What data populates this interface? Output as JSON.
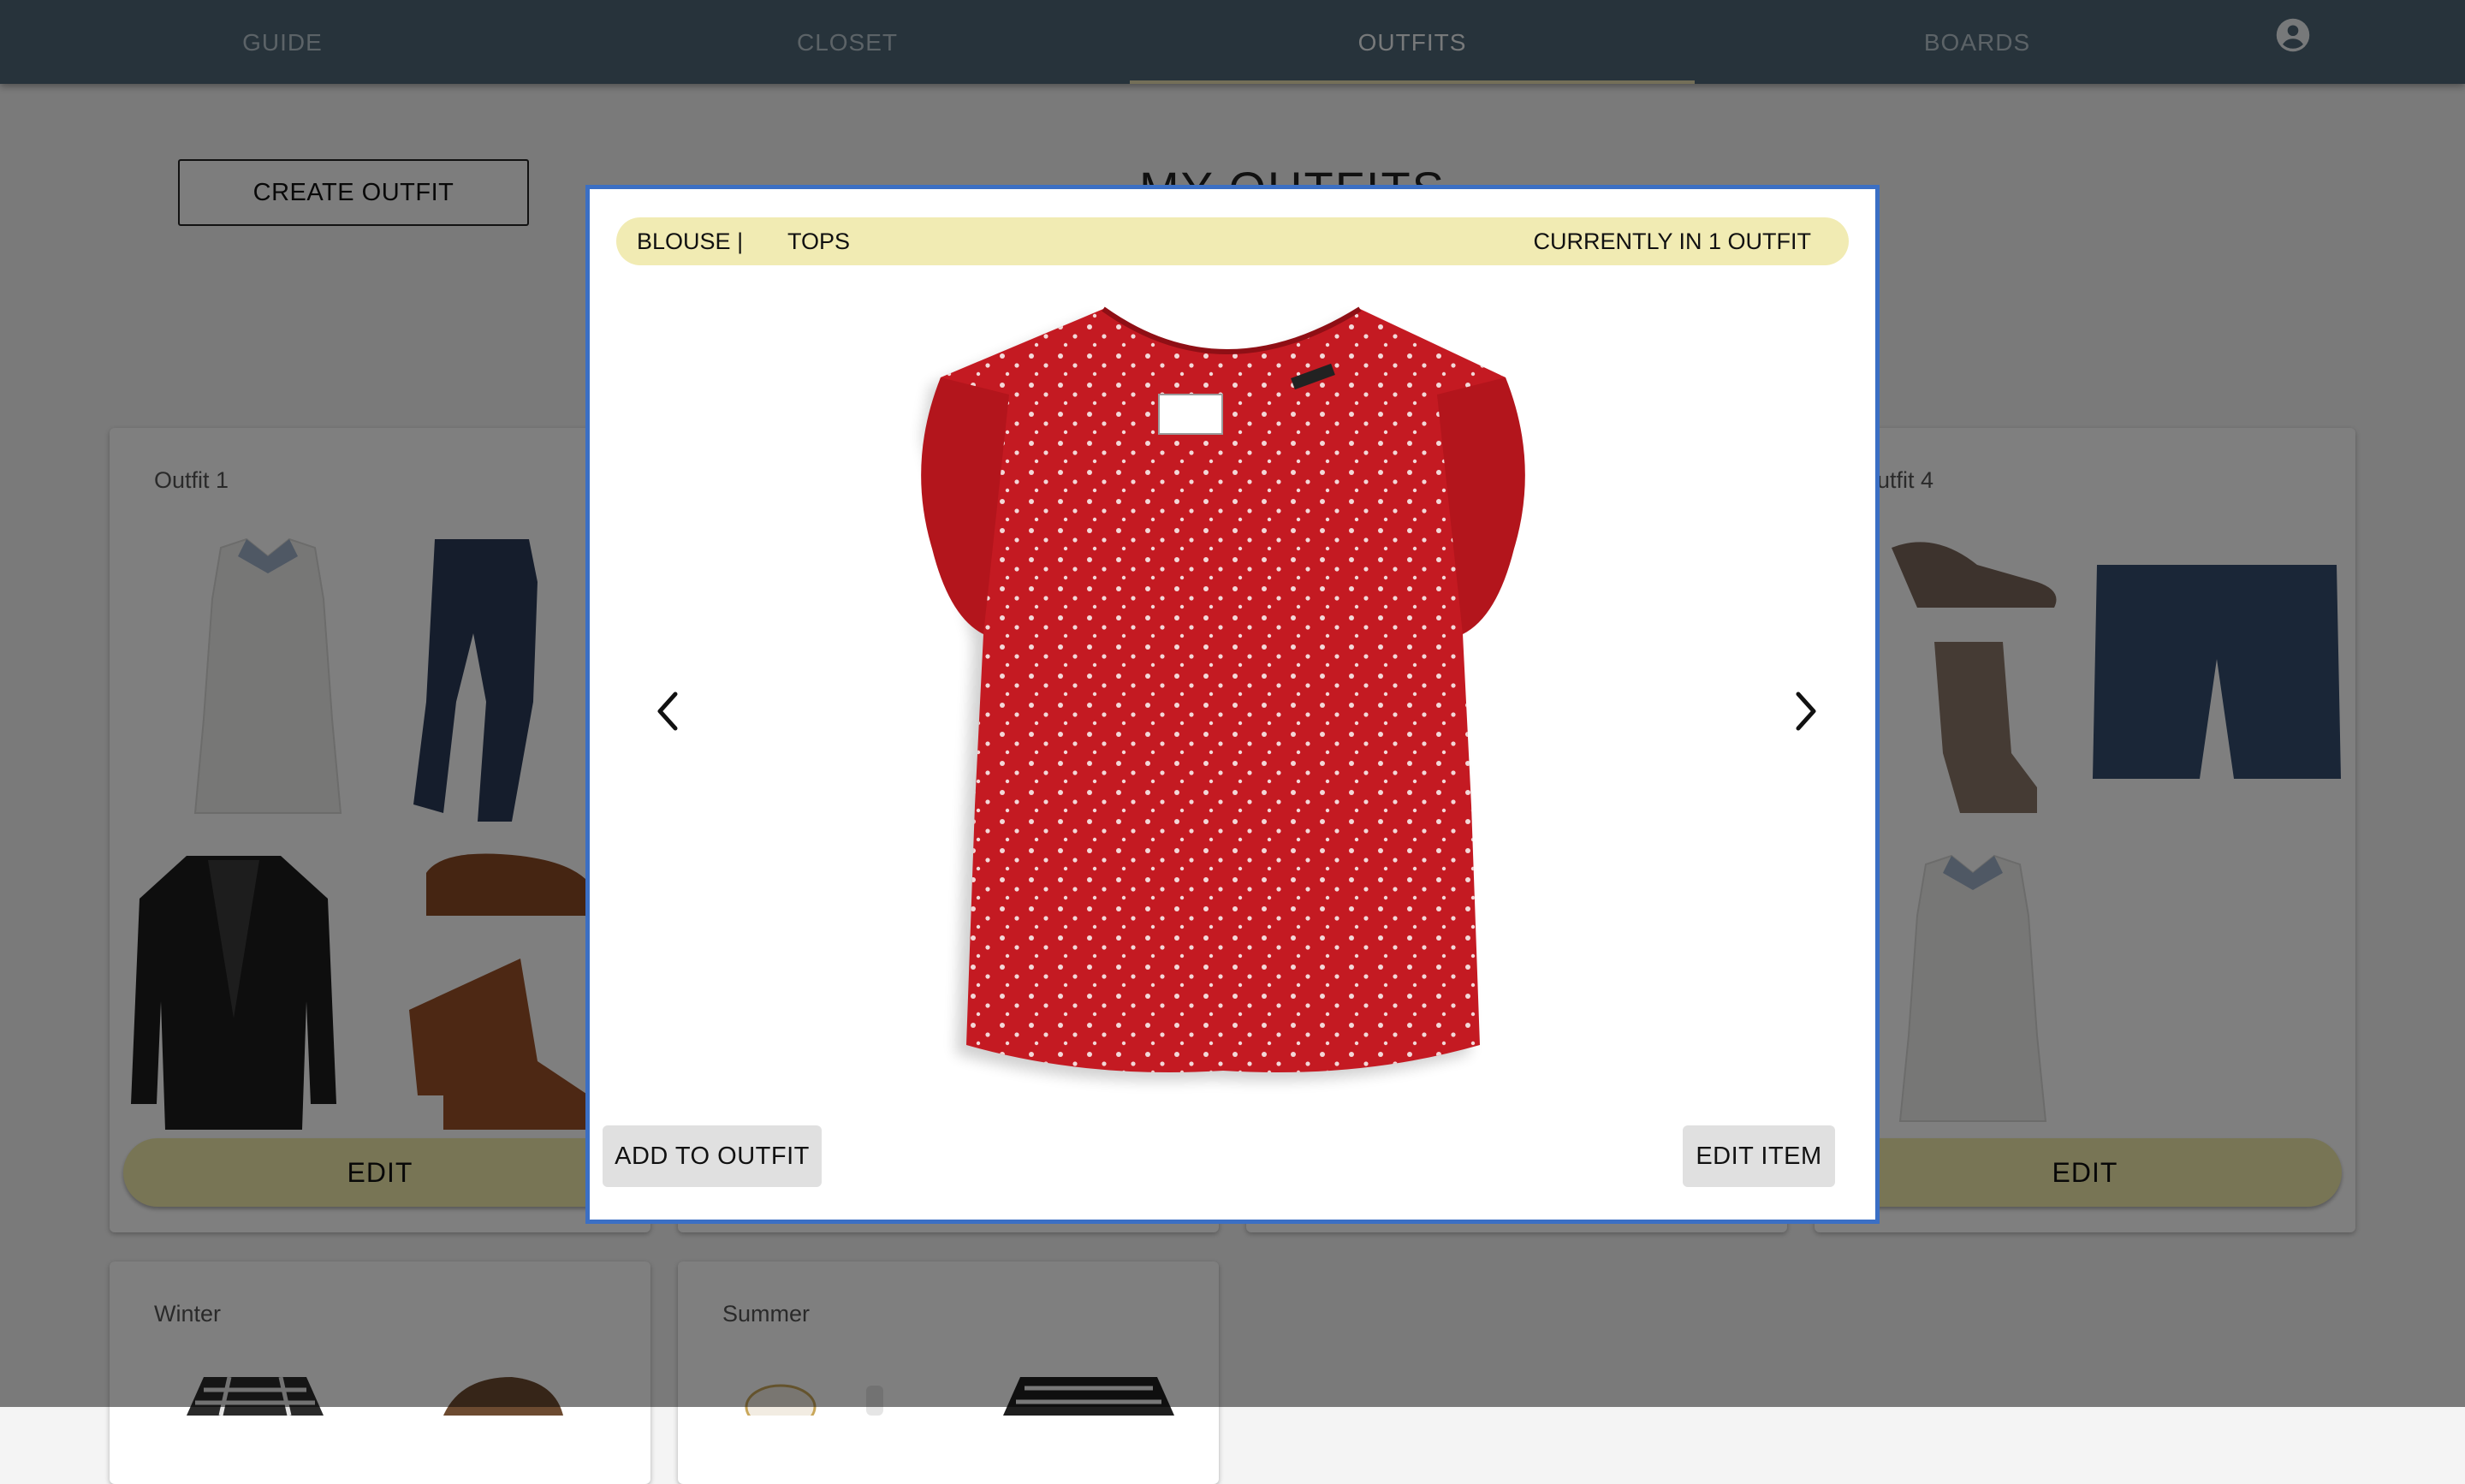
{
  "nav": {
    "tabs": [
      {
        "label": "GUIDE"
      },
      {
        "label": "CLOSET"
      },
      {
        "label": "OUTFITS"
      },
      {
        "label": "BOARDS"
      }
    ],
    "active_tab": "OUTFITS",
    "account_icon": "account-circle-icon"
  },
  "page": {
    "title": "MY OUTFITS",
    "create_button": "CREATE OUTFIT"
  },
  "outfits": [
    {
      "name": "Outfit 1",
      "edit_label": "EDIT"
    },
    {
      "name": "Outfit 4",
      "edit_label": "EDIT"
    },
    {
      "name": "Winter"
    },
    {
      "name": "Summer"
    }
  ],
  "modal": {
    "item_type": "BLOUSE",
    "separator": "|",
    "category": "TOPS",
    "usage": "CURRENTLY IN 1 OUTFIT",
    "add_button": "ADD TO OUTFIT",
    "edit_button": "EDIT ITEM",
    "prev_icon": "chevron-left-icon",
    "next_icon": "chevron-right-icon",
    "image": "red-polka-dot-flutter-sleeve-blouse"
  },
  "colors": {
    "nav_bg": "#4f6777",
    "accent_yellow": "#f1ebab",
    "modal_border": "#3b6fc4",
    "blouse_red": "#c41a22"
  }
}
